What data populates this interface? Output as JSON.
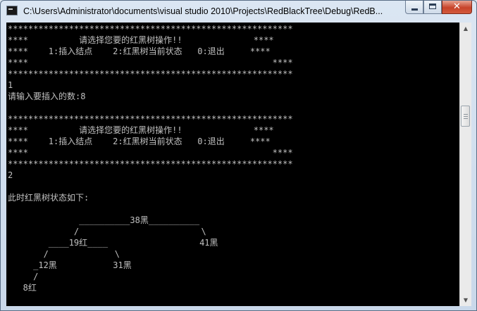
{
  "window": {
    "title": "C:\\Users\\Administrator\\documents\\visual studio 2010\\Projects\\RedBlackTree\\Debug\\RedB...",
    "close_glyph": "✕"
  },
  "console": {
    "lines": [
      "********************************************************",
      "****          请选择您要的红黑树操作!!              ****",
      "****    1:插入结点    2:红黑树当前状态   0:退出     ****",
      "****                                                ****",
      "********************************************************",
      "1",
      "请输入要插入的数:8",
      "",
      "********************************************************",
      "****          请选择您要的红黑树操作!!              ****",
      "****    1:插入结点    2:红黑树当前状态   0:退出     ****",
      "****                                                ****",
      "********************************************************",
      "2",
      "",
      "此时红黑树状态如下:",
      "",
      "              __________38黑__________",
      "             /                        \\",
      "        ____19红____                  41黑",
      "       /             \\",
      "     _12黑           31黑",
      "     /",
      "   8红"
    ]
  },
  "scrollbar": {
    "up_arrow": "▲",
    "down_arrow": "▼"
  }
}
